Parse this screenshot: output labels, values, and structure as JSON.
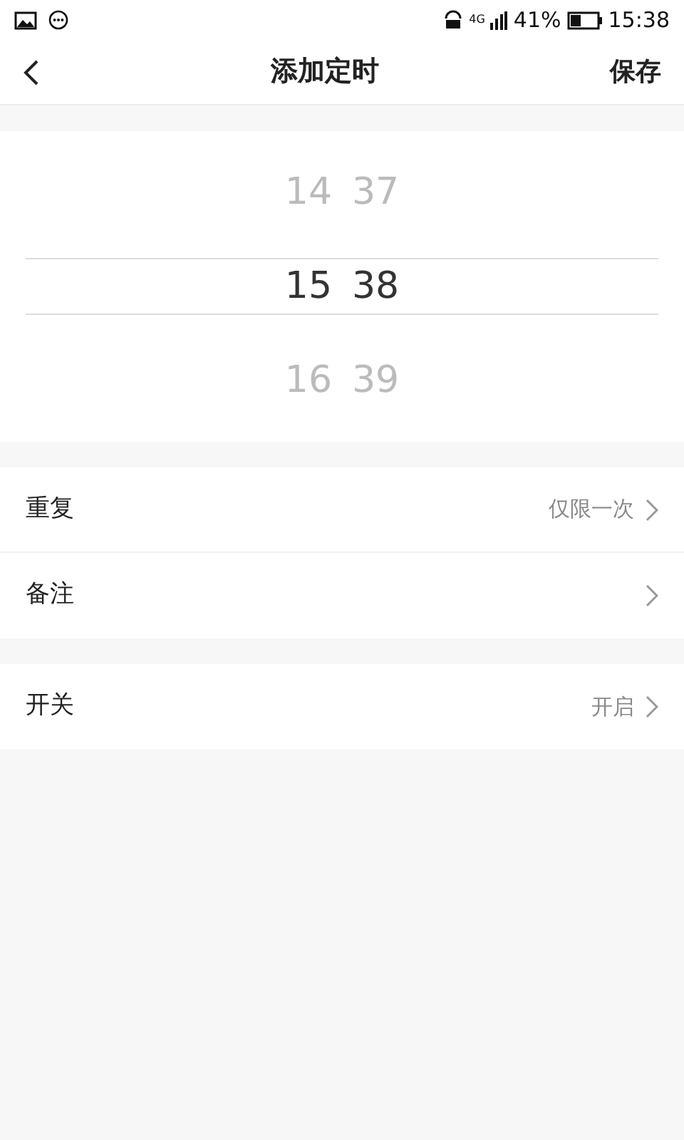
{
  "status_bar": {
    "network": "4G",
    "battery_percent": "41%",
    "time": "15:38"
  },
  "header": {
    "title": "添加定时",
    "action": "保存"
  },
  "picker": {
    "rows": [
      {
        "hour": "14",
        "minute": "37",
        "selected": false
      },
      {
        "hour": "15",
        "minute": "38",
        "selected": true
      },
      {
        "hour": "16",
        "minute": "39",
        "selected": false
      }
    ]
  },
  "groups": [
    {
      "items": [
        {
          "label": "重复",
          "value": "仅限一次"
        },
        {
          "label": "备注"
        }
      ]
    },
    {
      "items": [
        {
          "label": "开关",
          "value": "开启"
        }
      ]
    }
  ]
}
